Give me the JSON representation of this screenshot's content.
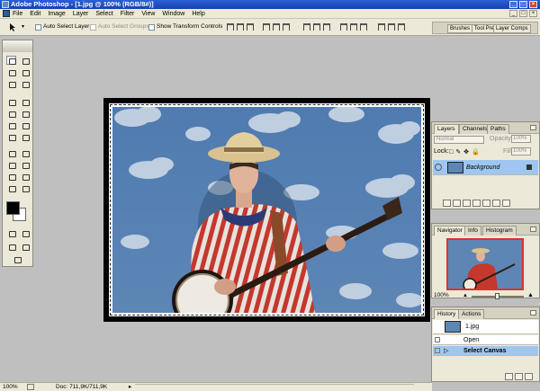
{
  "window": {
    "title": "Adobe Photoshop - [1.jpg @ 100% (RGB/8#)]"
  },
  "menus": [
    "File",
    "Edit",
    "Image",
    "Layer",
    "Select",
    "Filter",
    "View",
    "Window",
    "Help"
  ],
  "options": {
    "auto_select_layer": "Auto Select Layer",
    "auto_select_groups": "Auto Select Groups",
    "show_transform_controls": "Show Transform Controls"
  },
  "palette_well": {
    "tabs": [
      "Brushes",
      "Tool Pre",
      "Layer Comps"
    ]
  },
  "layers": {
    "tabs": [
      "Layers",
      "Channels",
      "Paths"
    ],
    "blend_mode": "Normal",
    "opacity_label": "Opacity:",
    "opacity_value": "100%",
    "lock_label": "Lock:",
    "fill_label": "Fill:",
    "fill_value": "100%",
    "layer_name": "Background"
  },
  "navigator": {
    "tabs": [
      "Navigator",
      "Info",
      "Histogram"
    ],
    "zoom": "100%",
    "view_box_color": "#e0302a"
  },
  "history": {
    "tabs": [
      "History",
      "Actions"
    ],
    "snapshot": "1.jpg",
    "items": [
      "Open",
      "Select Canvas"
    ]
  },
  "status": {
    "zoom": "100%",
    "doc": "Doc: 711,9K/711,9K"
  },
  "colors": {
    "foreground": "#000000",
    "background": "#ffffff",
    "selected_row": "#6aa1e6",
    "title_bar": "#2a5fd6"
  }
}
